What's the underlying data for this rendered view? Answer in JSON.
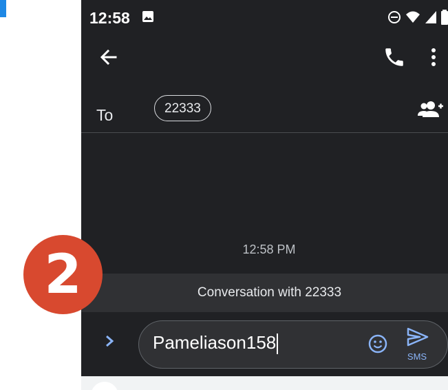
{
  "status_bar": {
    "time": "12:58",
    "icons": [
      "image-icon",
      "do-not-disturb-icon",
      "wifi-icon",
      "signal-icon",
      "battery-icon"
    ]
  },
  "app_bar": {
    "back_icon": "arrow-back-icon",
    "call_icon": "phone-icon",
    "more_icon": "more-vert-icon"
  },
  "recipients": {
    "label": "To",
    "chips": [
      "22333"
    ],
    "add_icon": "add-person-icon"
  },
  "conversation": {
    "timestamp": "12:58 PM",
    "banner": "Conversation with 22333"
  },
  "compose": {
    "value": "Pameliason158",
    "send_label": "SMS",
    "icons": [
      "chevron-right-icon",
      "emoji-icon",
      "send-icon"
    ]
  },
  "overlay": {
    "step_number": "2",
    "badge_color": "#d8492f"
  },
  "colors": {
    "background": "#202124",
    "accent": "#8ab4f8",
    "text": "#e8eaed"
  }
}
